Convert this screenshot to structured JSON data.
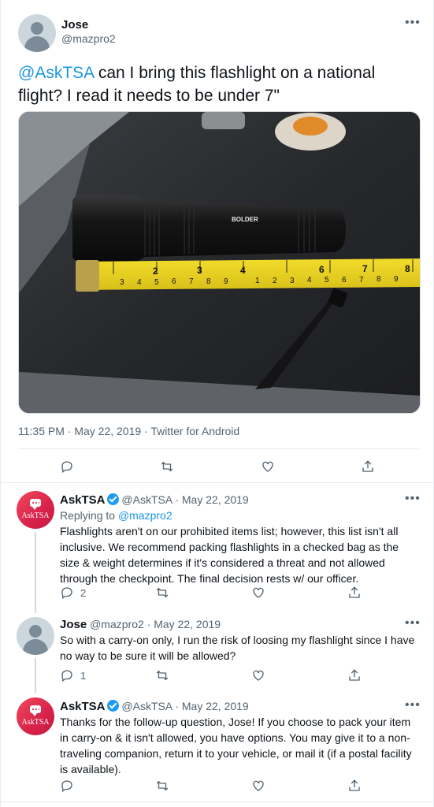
{
  "main_tweet": {
    "author_name": "Jose",
    "author_handle": "@mazpro2",
    "text_mention": "@AskTSA",
    "text_rest": " can I bring this flashlight on a national flight? I read it needs to be under 7\"",
    "photo_label": "BOLDER",
    "meta": "11:35 PM · May 22, 2019 · Twitter for Android",
    "more": "•••"
  },
  "replies": [
    {
      "author_name": "AskTSA",
      "author_handle": "@AskTSA",
      "date": "· May 22, 2019",
      "replying_prefix": "Replying to ",
      "replying_handle": "@mazpro2",
      "text": "Flashlights aren't on our prohibited items list; however, this list isn't all inclusive. We recommend packing flashlights in a checked bag as the size & weight determines if it's considered a threat and not allowed through the checkpoint. The final decision rests w/ our officer.",
      "reply_count": "2",
      "avatar_text": "AskTSA",
      "more": "•••"
    },
    {
      "author_name": "Jose",
      "author_handle": "@mazpro2",
      "date": "· May 22, 2019",
      "text": "So with a carry-on only, I run the risk of loosing my flashlight since I have no way to be sure it will be allowed?",
      "reply_count": "1",
      "more": "•••"
    },
    {
      "author_name": "AskTSA",
      "author_handle": "@AskTSA",
      "date": "· May 22, 2019",
      "text": "Thanks for the follow-up question, Jose! If you choose to pack your item in carry-on & it isn't allowed, you have options. You may give it to a non-traveling companion, return it to your vehicle, or mail it (if a postal facility is available).",
      "reply_count": "",
      "avatar_text": "AskTSA",
      "more": "•••"
    }
  ],
  "colors": {
    "link": "#1b95e0",
    "muted": "#536471",
    "verified": "#1d9bf0"
  },
  "icons": [
    "reply-icon",
    "retweet-icon",
    "like-icon",
    "share-icon",
    "verified-icon",
    "more-icon"
  ]
}
